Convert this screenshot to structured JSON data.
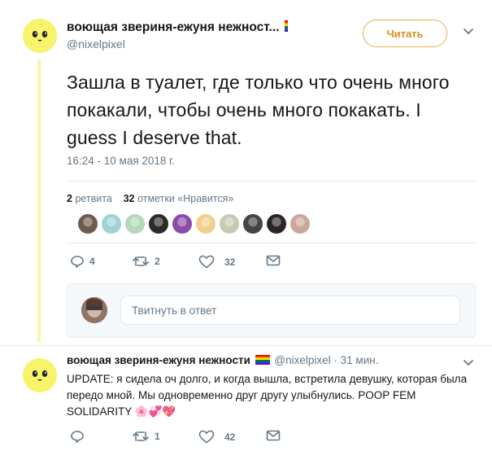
{
  "tweet": {
    "display_name": "воющая звериня-ежуня нежност...",
    "handle": "@nixelpixel",
    "follow_label": "Читать",
    "text": "Зашла в туалет, где только что очень много покакали, чтобы очень много покакать. I guess I deserve that.",
    "timestamp": "16:24 - 10 мая 2018 г.",
    "retweets_count": "2",
    "retweets_label": "ретвита",
    "likes_count": "32",
    "likes_label": "отметки «Нравится»",
    "actions": {
      "replies": "4",
      "retweets": "2",
      "likes": "32"
    },
    "likers": [
      {
        "icon": "liker-avatar-1",
        "color": "#6d5b4e"
      },
      {
        "icon": "liker-avatar-2",
        "color": "#9fd3d2"
      },
      {
        "icon": "liker-avatar-3",
        "color": "#b4d8b9"
      },
      {
        "icon": "liker-avatar-4",
        "color": "#2b2b2b"
      },
      {
        "icon": "liker-avatar-5",
        "color": "#8a4ca8"
      },
      {
        "icon": "liker-avatar-6",
        "color": "#efd08c"
      },
      {
        "icon": "liker-avatar-7",
        "color": "#c7c9b3"
      },
      {
        "icon": "liker-avatar-8",
        "color": "#444444"
      },
      {
        "icon": "liker-avatar-9",
        "color": "#2c2528"
      },
      {
        "icon": "liker-avatar-10",
        "color": "#c9a89b"
      }
    ]
  },
  "reply_box": {
    "placeholder": "Твитнуть в ответ"
  },
  "reply": {
    "display_name": "воющая звериня-ежуня нежности",
    "handle": "@nixelpixel",
    "time": "· 31 мин.",
    "text": "UPDATE: я сидела оч долго, и когда вышла, встретила девушку, которая была передо мной. Мы одновременно друг другу улыбнулись. POOP FEM SOLIDARITY",
    "emoji": "🌸💞💖",
    "actions": {
      "replies": "",
      "retweets": "1",
      "likes": "42"
    }
  },
  "colors": {
    "accent": "#d88f1f",
    "avatar_yellow": "#f7f36b",
    "muted": "#657786"
  }
}
